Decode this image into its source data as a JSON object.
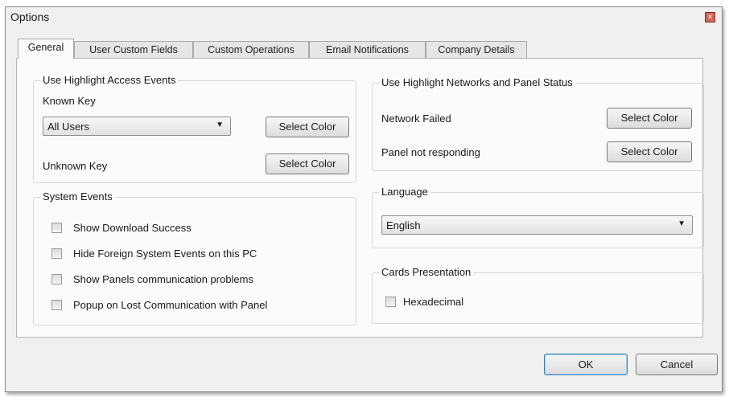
{
  "window": {
    "title": "Options",
    "close_glyph": "×"
  },
  "tabs": [
    {
      "label": "General",
      "active": true
    },
    {
      "label": "User Custom Fields",
      "active": false
    },
    {
      "label": "Custom Operations",
      "active": false
    },
    {
      "label": "Email Notifications",
      "active": false
    },
    {
      "label": "Company Details",
      "active": false
    }
  ],
  "access_events": {
    "title": "Use Highlight Access Events",
    "known_key_label": "Known Key",
    "known_key_select": "All Users",
    "known_key_button": "Select Color",
    "unknown_key_label": "Unknown Key",
    "unknown_key_button": "Select Color"
  },
  "network_status": {
    "title": "Use Highlight Networks and Panel Status",
    "network_failed_label": "Network Failed",
    "network_failed_button": "Select Color",
    "panel_not_responding_label": "Panel not responding",
    "panel_not_responding_button": "Select Color"
  },
  "system_events": {
    "title": "System Events",
    "options": [
      {
        "label": "Show Download Success",
        "checked": false
      },
      {
        "label": "Hide Foreign System Events on this PC",
        "checked": false
      },
      {
        "label": "Show Panels communication problems",
        "checked": false
      },
      {
        "label": "Popup on Lost Communication with Panel",
        "checked": false
      }
    ]
  },
  "language": {
    "title": "Language",
    "selected": "English"
  },
  "cards_presentation": {
    "title": "Cards Presentation",
    "hexadecimal_label": "Hexadecimal",
    "hexadecimal_checked": false
  },
  "footer": {
    "ok_label": "OK",
    "cancel_label": "Cancel"
  },
  "icons": {
    "dropdown_arrow": "▼"
  },
  "colors": {
    "close_button": "#c96a5c",
    "ok_border": "#3c7fb1",
    "window_bg": "#f0f0f0"
  }
}
